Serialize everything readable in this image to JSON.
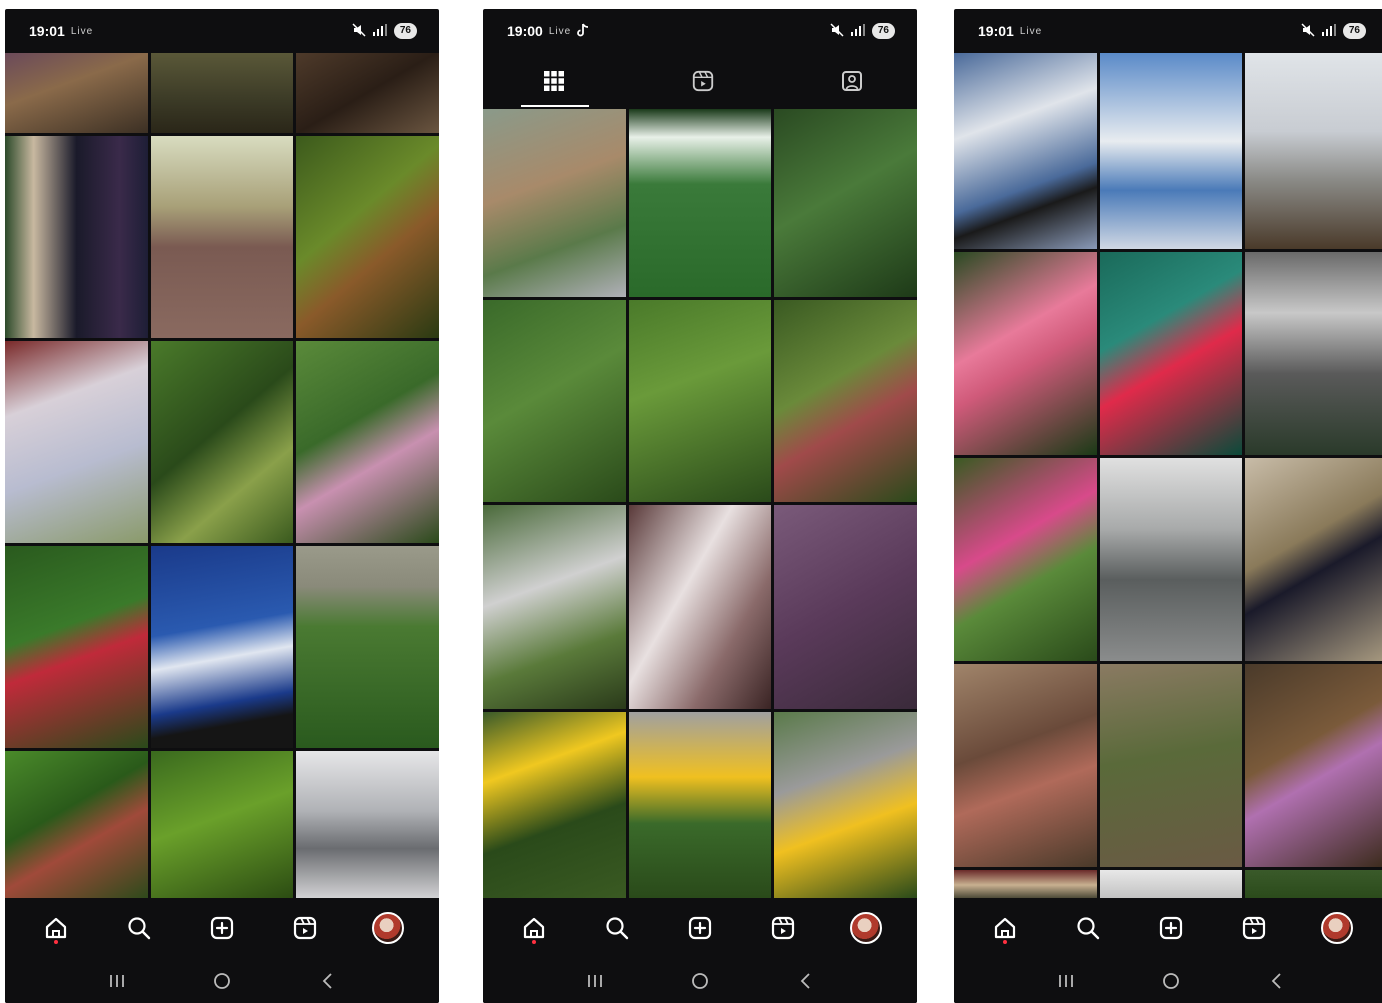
{
  "screens": [
    {
      "status": {
        "time": "19:01",
        "notif": "Live",
        "battery": "76"
      },
      "tiles": [
        "linear-gradient(160deg,#6b4a5a,#8a6a4a 40%,#3c3024)",
        "linear-gradient(180deg,#5a5838,#3b3a26 60%,#2a2618)",
        "linear-gradient(150deg,#4e3a2a,#2a1e16 50%,#6a5540)",
        "linear-gradient(90deg,#2c4a2a 0%,#c8b8a0 20%,#1a1a2a 50%,#3a2a4a 80%,#1e1e36)",
        "linear-gradient(180deg,#d8dcc0 0%,#a8a078 35%,#7a5a52 55%,#8a6a60 100%)",
        "linear-gradient(140deg,#3c5a1c,#6a8a2a 40%,#8a5a2a 60%,#2a3a12)",
        "linear-gradient(160deg,#7a2a2a 0%,#d8d0d8 30%,#b8bcd0 60%,#8a9a6a)",
        "linear-gradient(140deg,#4a7a2a,#2a4a1a 45%,#8aa04a 70%,#3a5a1e)",
        "linear-gradient(150deg,#5a8a3a,#3a6a2a 40%,#c890b0 60%,#2a4a1a)",
        "linear-gradient(160deg,#2a5a1e,#3a7a2a 40%,#c02a3a 55%,#2a4a1a)",
        "linear-gradient(170deg,#1a3a8a 0%,#2a5ab0 40%,#e0e6f0 55%,#1a3a8a 75%,#151515 85%)",
        "linear-gradient(180deg,#9a9a8a 0%,#8a8a7a 20%,#4a7a32 40%,#2a5a1e 100%)",
        "linear-gradient(150deg,#4a8a2a,#2a5a1a 40%,#a04a3a 60%,#2a4a1a)",
        "linear-gradient(160deg,#3a6a1e,#6aa02a 45%,#2a4a12)",
        "linear-gradient(180deg,#e6e6e8 0%,#b0b2b6 40%,#6a6c70 65%,#d8d8da 100%)"
      ]
    },
    {
      "status": {
        "time": "19:00",
        "notif": "Live",
        "battery": "76"
      },
      "tiles": [
        "linear-gradient(160deg,#8a9a8a,#a88a6a 40%,#5a7a4a 70%,#b0b0b8)",
        "linear-gradient(180deg,#1a3a1a 0%,#e8f0e8 15%,#3a7a3a 40%,#2a6a2a 100%)",
        "linear-gradient(150deg,#2a4a22,#4a7a3a 45%,#1e3a18)",
        "linear-gradient(150deg,#3a6a2a,#5a8a3a 45%,#2a4a1a)",
        "linear-gradient(160deg,#4a7a2a,#6a9a3a 40%,#2a4a1a)",
        "linear-gradient(150deg,#3a5a22,#6a8a3a 40%,#a04a4a 60%,#2a4a1a)",
        "linear-gradient(160deg,#4a6a3a,#d0d0d0 40%,#5a7a3a 70%,#2a3a1a)",
        "linear-gradient(120deg,#5a3a3a 0%,#e8e0e0 40%,#8a6a6a 70%,#3a2424)",
        "linear-gradient(150deg,#7a5a7a,#5a3a5a 50%,#3a2a3a)",
        "linear-gradient(160deg,#3a5a2a 0%,#f0c820 30%,#2a4a1a 60%,#3a5a22)",
        "linear-gradient(180deg,#a0a0a0 0%,#f0c020 35%,#3a6a2a 60%,#2a4a1a)",
        "linear-gradient(160deg,#5a7a4a 0%,#9a9a9a 35%,#f0c020 60%,#2a4a1a)"
      ]
    },
    {
      "status": {
        "time": "19:01",
        "notif": "Live",
        "battery": "76"
      },
      "tiles": [
        "linear-gradient(160deg,#4a6a9a 0%,#e0e4ea 35%,#4a6a9a 65%,#1a1a1a 75%,#8a9ab8)",
        "linear-gradient(180deg,#5a8ac8 0%,#e8ecf0 45%,#4a7ab8 70%,#d0d8e4)",
        "linear-gradient(180deg,#e0e4e8 0%,#c8ccd2 40%,#8a8a86 65%,#4a3a2a 100%)",
        "linear-gradient(150deg,#2a4a22,#e87a9a 40%,#d05a7a 55%,#1a3a16)",
        "linear-gradient(150deg,#1a6a5a 0%,#2a8a7a 35%,#e02a4a 55%,#0a4a3a)",
        "linear-gradient(180deg,#6a6a6a 0%,#c8c8c8 30%,#5a5a5a 60%,#2a3a2a 100%)",
        "linear-gradient(150deg,#3a5a22,#d84a8a 40%,#5a8a3a 60%,#2a4a1a)",
        "linear-gradient(180deg,#e0e0e0 0%,#a8aaaa 35%,#5a5e5e 60%,#8a8c8c 100%)",
        "linear-gradient(150deg,#c8bca8 0%,#8a7a5a 40%,#1a1a2a 55%,#a89a80 100%)",
        "linear-gradient(160deg,#a0846a,#6a4a3a 40%,#b06a5a 60%,#4a3a2a)",
        "linear-gradient(170deg,#8a7a62,#5a6a3a 45%,#6a5a44)",
        "linear-gradient(150deg,#4a3a2a,#7a5a3a 40%,#b070b0 55%,#3a2a1a)",
        "linear-gradient(180deg,#6a2a2a 0%,#c8b090 50%,#3a3a2a 100%)",
        "linear-gradient(180deg,#e8e8e8 0%,#c0c0c0 100%)",
        "linear-gradient(180deg,#3a5a2a 0%,#2a4a1a 100%)"
      ]
    }
  ]
}
